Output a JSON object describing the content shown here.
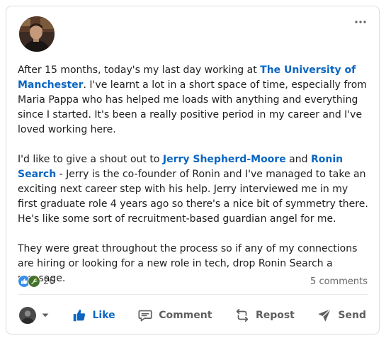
{
  "post": {
    "paragraph1": {
      "t1": "After 15 months, today's my last day working at ",
      "m1": "The University of Manchester",
      "t2": ". I've learnt a lot in a short space of time, especially from Maria Pappa who has helped me loads with anything and everything since I started. It's been a really positive period in my career and I've loved working here."
    },
    "paragraph2": {
      "t1": "I'd like to give a shout out to ",
      "m1": "Jerry Shepherd-Moore",
      "t2": " and ",
      "m2": "Ronin Search",
      "t3": " - Jerry is the co-founder of Ronin and I've managed to take an exciting next career step with his help. Jerry interviewed me in my first graduate role 4 years ago so there's a nice bit of symmetry there. He's like some sort of recruitment-based guardian angel for me."
    },
    "paragraph3": {
      "t1": "They were great throughout the process so if any of my connections are hiring or looking for a new role in tech, drop Ronin Search a message."
    }
  },
  "social": {
    "reaction_count": "26",
    "comments_label": "5 comments",
    "reaction_icons": [
      "like-reaction-icon",
      "celebrate-reaction-icon"
    ]
  },
  "actions": {
    "like": "Like",
    "comment": "Comment",
    "repost": "Repost",
    "send": "Send"
  },
  "colors": {
    "link": "#0a66c2",
    "like_active": "#0a66c2",
    "muted": "#666666",
    "text": "#1d1d1d",
    "celebrate": "#44712e"
  }
}
